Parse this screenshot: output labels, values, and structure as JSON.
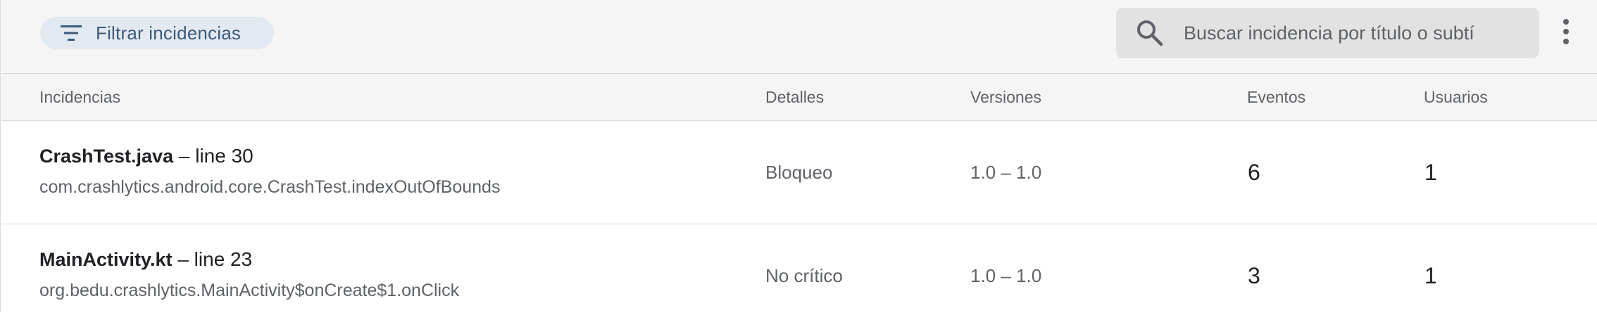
{
  "toolbar": {
    "filter_label": "Filtrar incidencias",
    "search_placeholder": "Buscar incidencia por título o subtí",
    "icons": {
      "filter": "filter-list-icon",
      "search": "search-icon",
      "more": "more-vert-icon"
    }
  },
  "table": {
    "columns": [
      "Incidencias",
      "Detalles",
      "Versiones",
      "Eventos",
      "Usuarios"
    ],
    "rows": [
      {
        "file": "CrashTest.java",
        "line": "– line 30",
        "subtitle": "com.crashlytics.android.core.CrashTest.indexOutOfBounds",
        "details": "Bloqueo",
        "versions": "1.0 – 1.0",
        "events": "6",
        "users": "1"
      },
      {
        "file": "MainActivity.kt",
        "line": "– line 23",
        "subtitle": "org.bedu.crashlytics.MainActivity$onCreate$1.onClick",
        "details": "No crítico",
        "versions": "1.0 – 1.0",
        "events": "3",
        "users": "1"
      }
    ]
  },
  "colors": {
    "chip_bg": "#e3e9f0",
    "chip_text": "#3c5a7c",
    "toolbar_bg": "#f5f5f5",
    "search_bg": "#e2e2e2",
    "secondary_text": "#5f6368",
    "primary_text": "#202124"
  }
}
